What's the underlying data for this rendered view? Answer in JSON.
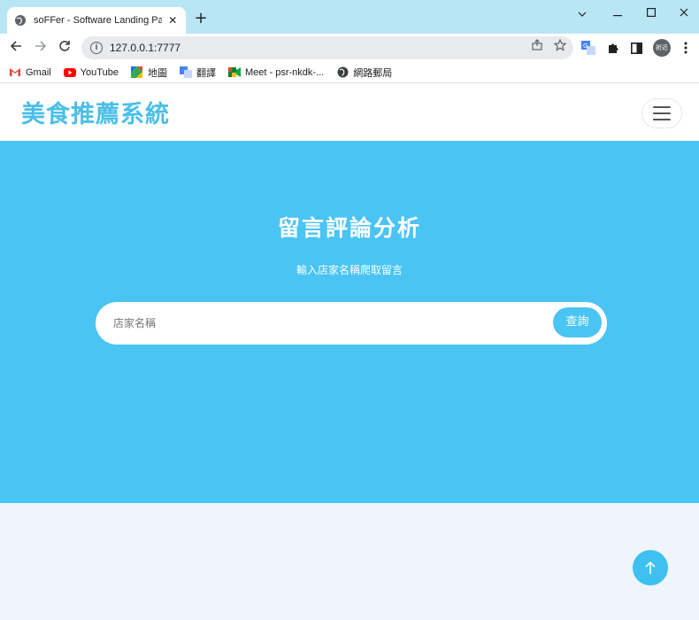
{
  "browser": {
    "tab_title": "soFFer - Software Landing Page",
    "tab_close": "✕",
    "new_tab": "+",
    "url": "127.0.0.1:7777",
    "profile_label": "祈近",
    "bookmarks": [
      {
        "label": "Gmail",
        "icon": "gmail-icon"
      },
      {
        "label": "YouTube",
        "icon": "youtube-icon"
      },
      {
        "label": "地圖",
        "icon": "maps-icon"
      },
      {
        "label": "翻譯",
        "icon": "translate-icon"
      },
      {
        "label": "Meet - psr-nkdk-...",
        "icon": "meet-icon"
      },
      {
        "label": "網路郵局",
        "icon": "globe-icon"
      }
    ]
  },
  "nav": {
    "brand": "美食推薦系統"
  },
  "hero": {
    "title": "留言評論分析",
    "subtitle": "輸入店家名稱爬取留言",
    "search_placeholder": "店家名稱",
    "search_button": "查詢"
  },
  "colors": {
    "accent": "#4ac4f3",
    "brand": "#4bbfe8",
    "page_bg": "#eef5fc"
  }
}
